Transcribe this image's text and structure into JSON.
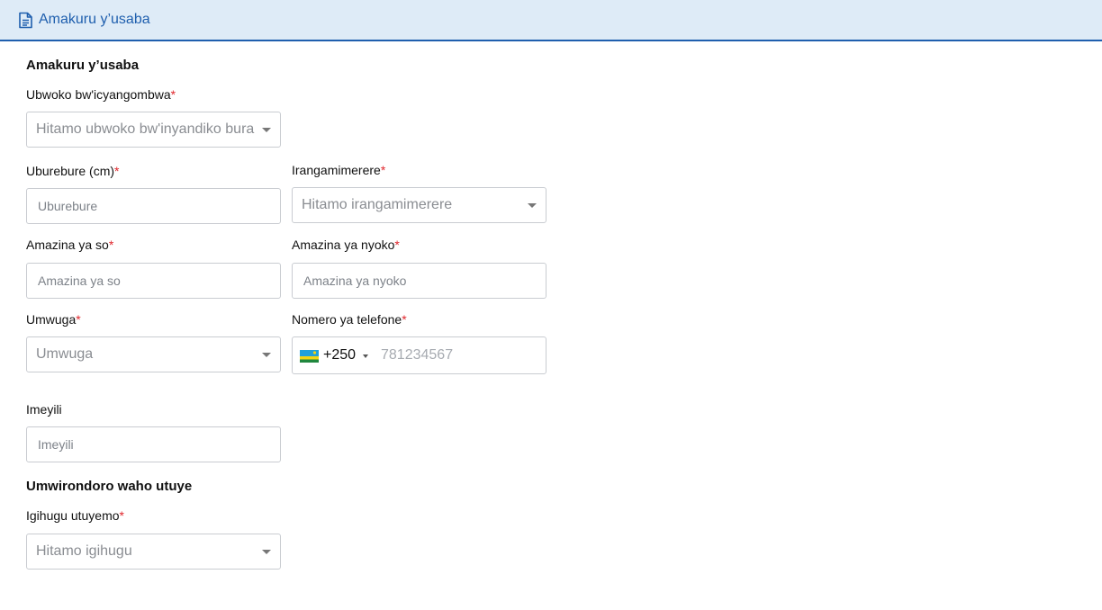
{
  "tab": {
    "label": "Amakuru y’usaba",
    "icon": "document-icon"
  },
  "section1": {
    "title": "Amakuru y’usaba"
  },
  "fields": {
    "document_type": {
      "label": "Ubwoko bw'icyangombwa",
      "required": "*",
      "placeholder": "Hitamo ubwoko bw'inyandiko bura"
    },
    "height": {
      "label": "Uburebure (cm)",
      "required": "*",
      "placeholder": "Uburebure"
    },
    "eye_color": {
      "label": "Irangamimerere",
      "required": "*",
      "placeholder": "Hitamo irangamimerere"
    },
    "father_name": {
      "label": "Amazina ya so",
      "required": "*",
      "placeholder": "Amazina ya so"
    },
    "mother_name": {
      "label": "Amazina ya nyoko",
      "required": "*",
      "placeholder": "Amazina ya nyoko"
    },
    "occupation": {
      "label": "Umwuga",
      "required": "*",
      "placeholder": "Umwuga"
    },
    "phone": {
      "label": "Nomero ya telefone",
      "required": "*",
      "dial_code": "+250",
      "placeholder": "781234567",
      "flag": "rwanda-flag-icon"
    },
    "email": {
      "label": "Imeyili",
      "placeholder": "Imeyili"
    },
    "country": {
      "label": "Igihugu utuyemo",
      "required": "*",
      "placeholder": "Hitamo igihugu"
    }
  },
  "section2": {
    "title": "Umwirondoro waho utuye"
  },
  "colors": {
    "accent": "#1f5fae",
    "tab_bg": "#deebf7",
    "required": "#e0282e",
    "border": "#c9ccd1"
  }
}
